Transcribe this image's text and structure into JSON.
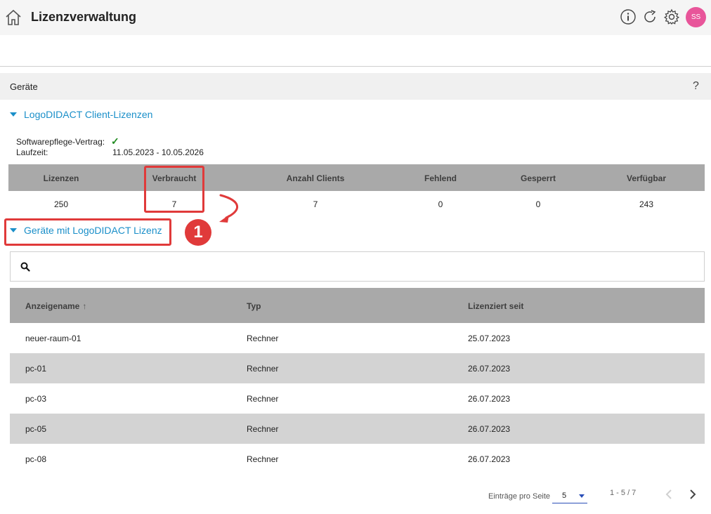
{
  "header": {
    "title": "Lizenzverwaltung",
    "avatar_initials": "SS",
    "icons": [
      "home-icon",
      "info-icon",
      "refresh-icon",
      "gear-icon"
    ]
  },
  "section": {
    "title": "Geräte",
    "help_label": "?"
  },
  "client_licenses": {
    "label": "LogoDIDACT Client-Lizenzen",
    "maintenance_label": "Softwarepflege-Vertrag:",
    "maintenance_value": "✓",
    "runtime_label": "Laufzeit:",
    "runtime_value": "11.05.2023 - 10.05.2026",
    "table": {
      "headers": [
        "Lizenzen",
        "Verbraucht",
        "Anzahl Clients",
        "Fehlend",
        "Gesperrt",
        "Verfügbar"
      ],
      "values": [
        "250",
        "7",
        "7",
        "0",
        "0",
        "243"
      ]
    }
  },
  "annotation": {
    "badge": "1",
    "color": "#e03a3a"
  },
  "devices": {
    "label": "Geräte mit LogoDIDACT Lizenz",
    "search": {
      "value": "",
      "placeholder": ""
    },
    "columns": [
      "Anzeigename",
      "Typ",
      "Lizenziert seit"
    ],
    "sort_indicator": "↑",
    "rows": [
      [
        "neuer-raum-01",
        "Rechner",
        "25.07.2023"
      ],
      [
        "pc-01",
        "Rechner",
        "26.07.2023"
      ],
      [
        "pc-03",
        "Rechner",
        "26.07.2023"
      ],
      [
        "pc-05",
        "Rechner",
        "26.07.2023"
      ],
      [
        "pc-08",
        "Rechner",
        "26.07.2023"
      ]
    ]
  },
  "pagination": {
    "per_page_label": "Einträge pro Seite",
    "per_page_value": "5",
    "range": "1 - 5 / 7"
  },
  "colors": {
    "accent": "#1a8fc9",
    "avatar": "#e8559a",
    "table_header": "#a9a9a9",
    "row_alt": "#d3d3d3"
  }
}
